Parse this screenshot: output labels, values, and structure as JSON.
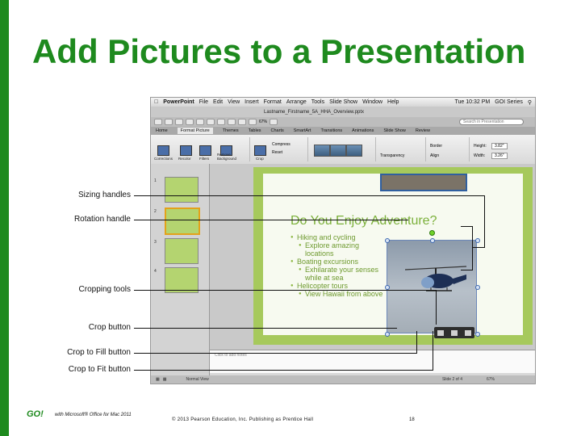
{
  "slide_title": "Add Pictures to a Presentation",
  "callouts": {
    "sizing": "Sizing handles",
    "rotation": "Rotation handle",
    "cropping": "Cropping tools",
    "crop_button": "Crop button",
    "crop_fill": "Crop to Fill button",
    "crop_fit": "Crop to Fit button"
  },
  "screenshot": {
    "menubar": {
      "app": "PowerPoint",
      "items": [
        "File",
        "Edit",
        "View",
        "Insert",
        "Format",
        "Arrange",
        "Tools",
        "Slide Show",
        "Window",
        "Help"
      ],
      "clock": "Tue 10:32 PM",
      "user": "GOI Series"
    },
    "doc_title": "Lastname_Firstname_5A_HHA_Overview.pptx",
    "zoom": "67%",
    "search_placeholder": "Search in Presentation",
    "tabs": [
      "Home",
      "Format Picture",
      "Themes",
      "Tables",
      "Charts",
      "SmartArt",
      "Transitions",
      "Animations",
      "Slide Show",
      "Review"
    ],
    "ribbon": {
      "corrections": "Corrections",
      "recolor": "Recolor",
      "filters": "Filters",
      "remove_bg": "Remove Background",
      "crop": "Crop",
      "compress": "Compress",
      "reset": "Reset",
      "transparency": "Transparency",
      "border": "Border",
      "align": "Align",
      "height_label": "Height:",
      "height_value": "3.82\"",
      "width_label": "Width:",
      "width_value": "3.26\""
    },
    "slide_numbers": [
      "1",
      "2",
      "3",
      "4"
    ],
    "slide": {
      "heading": "Do You Enjoy Adventure?",
      "bullets": [
        {
          "level": 1,
          "text": "Hiking and cycling"
        },
        {
          "level": 2,
          "text": "Explore amazing locations"
        },
        {
          "level": 1,
          "text": "Boating excursions"
        },
        {
          "level": 2,
          "text": "Exhilarate your senses while at sea"
        },
        {
          "level": 1,
          "text": "Helicopter tours"
        },
        {
          "level": 2,
          "text": "View Hawaii from above"
        }
      ]
    },
    "notes_placeholder": "Click to add notes",
    "status": {
      "view": "Normal View",
      "slide_count": "Slide 2 of 4",
      "zoom": "67%"
    }
  },
  "footer": {
    "logo": "GO!",
    "with_text": "with Microsoft® Office for Mac 2011",
    "copyright": "© 2013 Pearson Education, Inc. Publishing as Prentice Hall",
    "page": "18"
  },
  "colors": {
    "accent_green": "#1e8a1e",
    "slide_green": "#a6c95c",
    "heading_green": "#7bb03a"
  }
}
